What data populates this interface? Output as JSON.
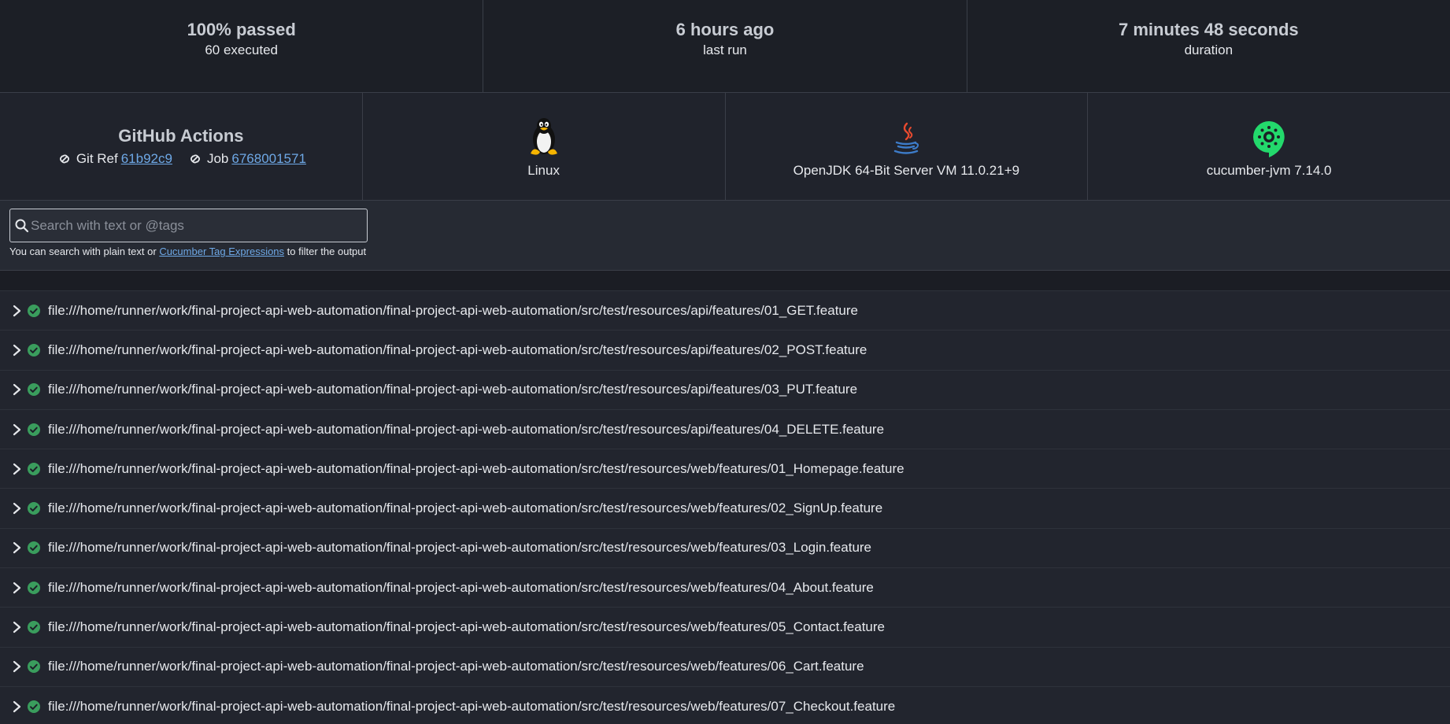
{
  "stats": {
    "passed": {
      "primary": "100% passed",
      "secondary": "60 executed"
    },
    "last_run": {
      "primary": "6 hours ago",
      "secondary": "last run"
    },
    "duration": {
      "primary": "7 minutes 48 seconds",
      "secondary": "duration"
    }
  },
  "environment": {
    "ci": {
      "name": "GitHub Actions",
      "git_ref_label": "Git Ref",
      "git_ref_value": "61b92c9",
      "job_label": "Job",
      "job_value": "6768001571"
    },
    "os": {
      "label": "Linux",
      "icon": "linux-tux-icon"
    },
    "runtime": {
      "label": "OpenJDK 64-Bit Server VM 11.0.21+9",
      "icon": "java-icon"
    },
    "implementation": {
      "label": "cucumber-jvm 7.14.0",
      "icon": "cucumber-icon"
    }
  },
  "search": {
    "placeholder": "Search with text or @tags",
    "hint_before": "You can search with plain text or",
    "hint_link": "Cucumber Tag Expressions",
    "hint_after": "to filter the output"
  },
  "colors": {
    "pass": "#3a9d5d",
    "link": "#6ea8e6"
  },
  "features": [
    "file:///home/runner/work/final-project-api-web-automation/final-project-api-web-automation/src/test/resources/api/features/01_GET.feature",
    "file:///home/runner/work/final-project-api-web-automation/final-project-api-web-automation/src/test/resources/api/features/02_POST.feature",
    "file:///home/runner/work/final-project-api-web-automation/final-project-api-web-automation/src/test/resources/api/features/03_PUT.feature",
    "file:///home/runner/work/final-project-api-web-automation/final-project-api-web-automation/src/test/resources/api/features/04_DELETE.feature",
    "file:///home/runner/work/final-project-api-web-automation/final-project-api-web-automation/src/test/resources/web/features/01_Homepage.feature",
    "file:///home/runner/work/final-project-api-web-automation/final-project-api-web-automation/src/test/resources/web/features/02_SignUp.feature",
    "file:///home/runner/work/final-project-api-web-automation/final-project-api-web-automation/src/test/resources/web/features/03_Login.feature",
    "file:///home/runner/work/final-project-api-web-automation/final-project-api-web-automation/src/test/resources/web/features/04_About.feature",
    "file:///home/runner/work/final-project-api-web-automation/final-project-api-web-automation/src/test/resources/web/features/05_Contact.feature",
    "file:///home/runner/work/final-project-api-web-automation/final-project-api-web-automation/src/test/resources/web/features/06_Cart.feature",
    "file:///home/runner/work/final-project-api-web-automation/final-project-api-web-automation/src/test/resources/web/features/07_Checkout.feature"
  ]
}
